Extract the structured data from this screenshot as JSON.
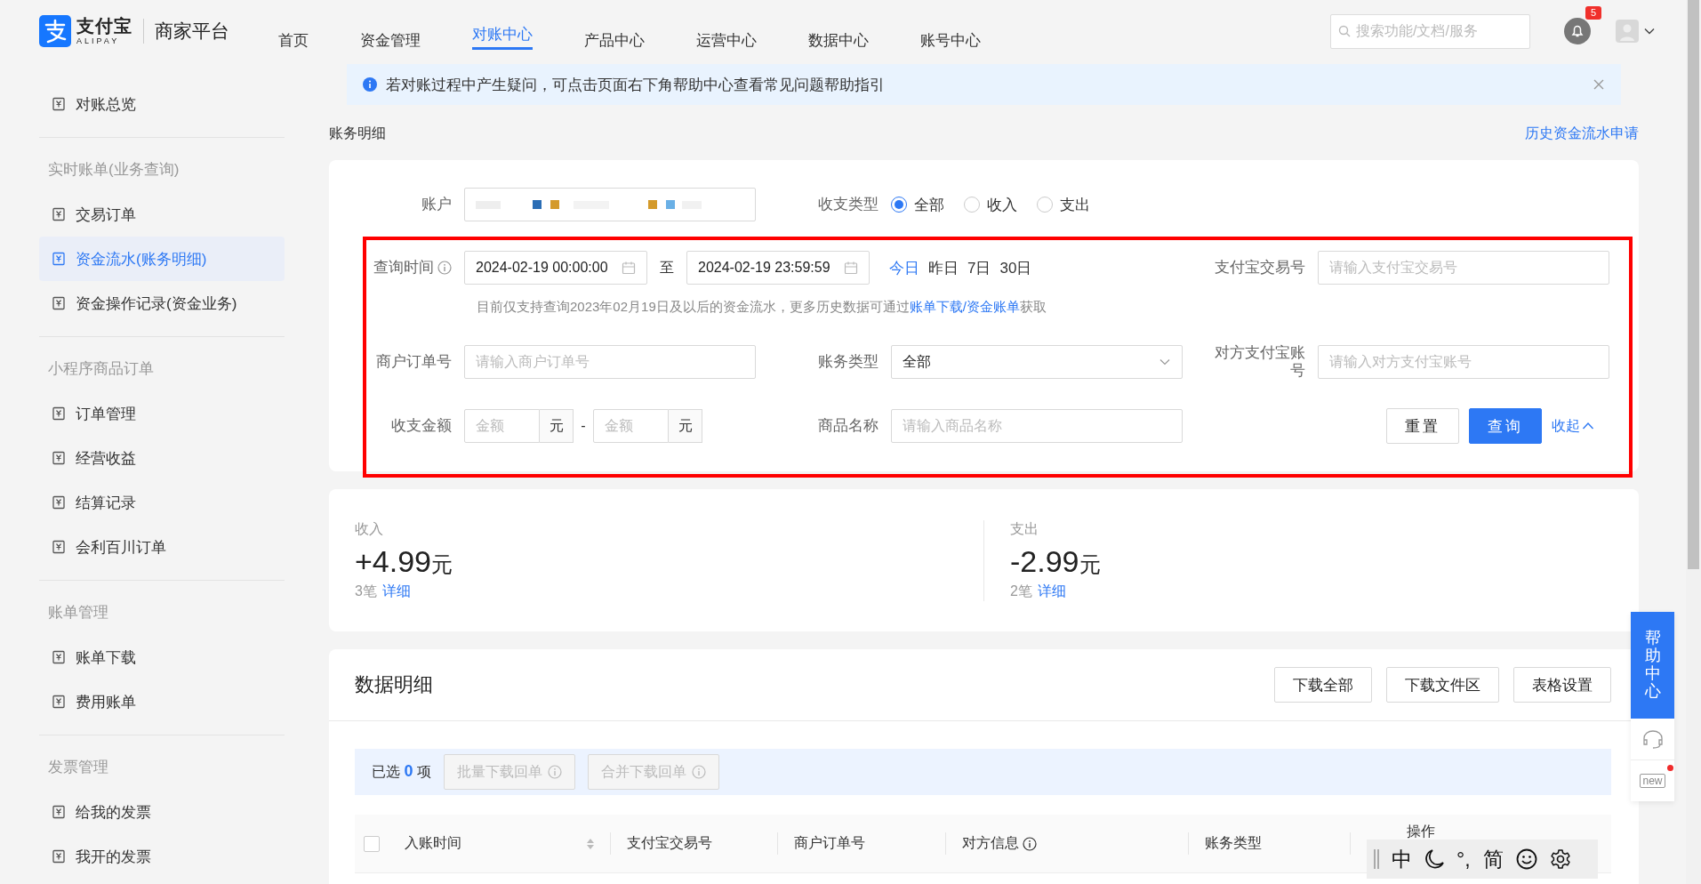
{
  "header": {
    "logo_name": "支付宝",
    "logo_sub": "ALIPAY",
    "platform": "商家平台",
    "nav": [
      {
        "label": "首页",
        "selected": false
      },
      {
        "label": "资金管理",
        "selected": false
      },
      {
        "label": "对账中心",
        "selected": true
      },
      {
        "label": "产品中心",
        "selected": false
      },
      {
        "label": "运营中心",
        "selected": false
      },
      {
        "label": "数据中心",
        "selected": false
      },
      {
        "label": "账号中心",
        "selected": false
      }
    ],
    "search": {
      "placeholder": "搜索功能/文档/服务"
    },
    "notification_count": "5"
  },
  "sidebar": {
    "sections": [
      {
        "items": [
          {
            "label": "对账总览",
            "selected": false
          }
        ]
      },
      {
        "title": "实时账单(业务查询)",
        "items": [
          {
            "label": "交易订单",
            "selected": false
          },
          {
            "label": "资金流水(账务明细)",
            "selected": true
          },
          {
            "label": "资金操作记录(资金业务)",
            "selected": false
          }
        ]
      },
      {
        "title": "小程序商品订单",
        "items": [
          {
            "label": "订单管理",
            "selected": false
          },
          {
            "label": "经营收益",
            "selected": false
          },
          {
            "label": "结算记录",
            "selected": false
          },
          {
            "label": "会利百川订单",
            "selected": false
          }
        ]
      },
      {
        "title": "账单管理",
        "items": [
          {
            "label": "账单下载",
            "selected": false
          },
          {
            "label": "费用账单",
            "selected": false
          }
        ]
      },
      {
        "title": "发票管理",
        "items": [
          {
            "label": "给我的发票",
            "selected": false
          },
          {
            "label": "我开的发票",
            "selected": false
          }
        ]
      }
    ]
  },
  "alert": {
    "text": "若对账过程中产生疑问，可点击页面右下角帮助中心查看常见问题帮助指引"
  },
  "page_title": "账务明细",
  "history_link": "历史资金流水申请",
  "filters": {
    "account": {
      "label": "账户"
    },
    "flow_type": {
      "label": "收支类型",
      "options": [
        {
          "label": "全部",
          "selected": true
        },
        {
          "label": "收入",
          "selected": false
        },
        {
          "label": "支出",
          "selected": false
        }
      ]
    },
    "query_time": {
      "label": "查询时间",
      "start": "2024-02-19 00:00:00",
      "separator": "至",
      "end": "2024-02-19 23:59:59",
      "quick": [
        {
          "label": "今日",
          "selected": true
        },
        {
          "label": "昨日",
          "selected": false
        },
        {
          "label": "7日",
          "selected": false
        },
        {
          "label": "30日",
          "selected": false
        }
      ],
      "hint": "目前仅支持查询2023年02月19日及以后的资金流水，更多历史数据可通过",
      "hint_link": "账单下载/资金账单",
      "hint_end": "获取"
    },
    "trade_no": {
      "label": "支付宝交易号",
      "placeholder": "请输入支付宝交易号"
    },
    "merchant_order_no": {
      "label": "商户订单号",
      "placeholder": "请输入商户订单号"
    },
    "bill_type": {
      "label": "账务类型",
      "value": "全部"
    },
    "counterparty": {
      "label": "对方支付宝账号",
      "placeholder": "请输入对方支付宝账号"
    },
    "amount": {
      "label": "收支金额",
      "min_placeholder": "金额",
      "min_unit": "元",
      "dash": "-",
      "max_placeholder": "金额",
      "max_unit": "元"
    },
    "product_name": {
      "label": "商品名称",
      "placeholder": "请输入商品名称"
    },
    "reset": "重置",
    "query": "查询",
    "collapse": "收起"
  },
  "summary": [
    {
      "label": "收入",
      "amount": "+4.99",
      "unit": "元",
      "count": "3笔",
      "detail": "详细"
    },
    {
      "label": "支出",
      "amount": "-2.99",
      "unit": "元",
      "count": "2笔",
      "detail": "详细"
    }
  ],
  "data": {
    "title": "数据明细",
    "buttons": [
      "下载全部",
      "下载文件区",
      "表格设置"
    ],
    "selection": {
      "prefix": "已选",
      "count": "0",
      "suffix": "项",
      "actions": [
        {
          "label": "批量下载回单",
          "disabled": true
        },
        {
          "label": "合并下载回单",
          "disabled": true
        }
      ]
    },
    "table": {
      "select_all": false,
      "columns": [
        {
          "label": "入账时间",
          "sortable": true,
          "info": false
        },
        {
          "label": "支付宝交易号",
          "sortable": false,
          "info": false
        },
        {
          "label": "商户订单号",
          "sortable": false,
          "info": false
        },
        {
          "label": "对方信息",
          "sortable": false,
          "info": true
        },
        {
          "label": "账务类型",
          "sortable": false,
          "info": false
        },
        {
          "label": "操作",
          "sortable": false,
          "info": false
        }
      ]
    }
  },
  "help": {
    "label": "帮助中心",
    "new_label": "new"
  },
  "ime": {
    "mode": "中",
    "punct": "°,",
    "script": "简"
  }
}
